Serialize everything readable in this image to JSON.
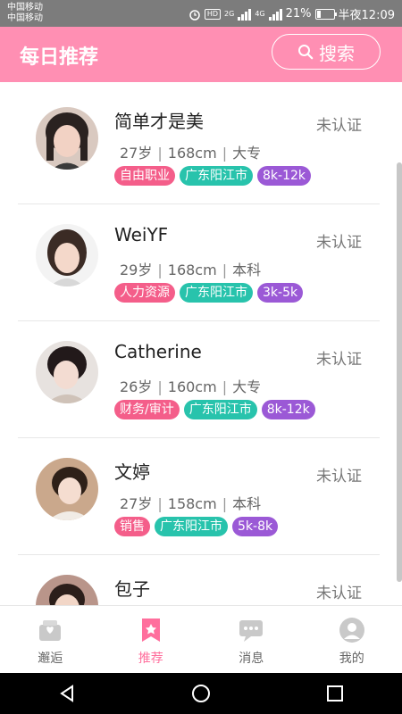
{
  "status_bar": {
    "carrier1": "中国移动",
    "carrier2": "中国移动",
    "hd": "HD",
    "net1": "2G",
    "net2": "4G",
    "battery_text": "21%",
    "battery_level": 0.21,
    "time": "半夜12:09",
    "icons": [
      "alarm-icon",
      "signal-icon",
      "battery-icon"
    ]
  },
  "header": {
    "title": "每日推荐",
    "search_label": "搜索",
    "search_icon": "search-icon"
  },
  "cards": [
    {
      "name": "简单才是美",
      "status": "未认证",
      "age": "27岁",
      "height": "168cm",
      "education": "大专",
      "tags": [
        "自由职业",
        "广东阳江市",
        "8k-12k"
      ]
    },
    {
      "name": "WeiYF",
      "status": "未认证",
      "age": "29岁",
      "height": "168cm",
      "education": "本科",
      "tags": [
        "人力资源",
        "广东阳江市",
        "3k-5k"
      ]
    },
    {
      "name": "Catherine",
      "status": "未认证",
      "age": "26岁",
      "height": "160cm",
      "education": "大专",
      "tags": [
        "财务/审计",
        "广东阳江市",
        "8k-12k"
      ]
    },
    {
      "name": "文婷",
      "status": "未认证",
      "age": "27岁",
      "height": "158cm",
      "education": "本科",
      "tags": [
        "销售",
        "广东阳江市",
        "5k-8k"
      ]
    },
    {
      "name": "包子",
      "status": "未认证"
    }
  ],
  "separator": "|",
  "tab_bar": {
    "tabs": [
      {
        "label": "邂逅",
        "icon": "encounter-icon",
        "active": false
      },
      {
        "label": "推荐",
        "icon": "recommend-bookmark-icon",
        "active": true
      },
      {
        "label": "消息",
        "icon": "message-icon",
        "active": false
      },
      {
        "label": "我的",
        "icon": "profile-icon",
        "active": false
      }
    ]
  },
  "colors": {
    "header": "#ff8fb3",
    "accent": "#ff6f9d",
    "tag_job": "#f45e8a",
    "tag_city": "#28c3ac",
    "tag_income": "#9b59d6"
  }
}
